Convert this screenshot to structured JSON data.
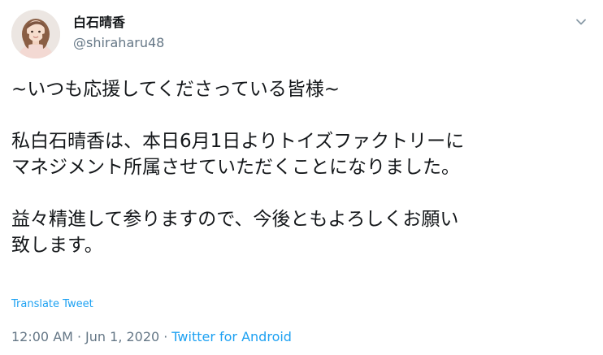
{
  "user": {
    "display_name": "白石晴香",
    "handle": "@shiraharu48"
  },
  "tweet": {
    "lines": [
      "~いつも応援してくださっている皆様~",
      "私白石晴香は、本日6月1日よりトイズファクトリーに",
      "マネジメント所属させていただくことになりました。",
      "益々精進して参りますので、今後ともよろしくお願い",
      "致します。"
    ]
  },
  "translate_label": "Translate Tweet",
  "meta": {
    "time": "12:00 AM",
    "separator": "·",
    "date": "Jun 1, 2020",
    "source": "Twitter for Android"
  },
  "colors": {
    "link": "#1da1f2",
    "secondary_text": "#657786",
    "primary_text": "#14171a"
  },
  "icons": {
    "avatar": "profile-photo",
    "menu": "chevron-down-icon"
  }
}
